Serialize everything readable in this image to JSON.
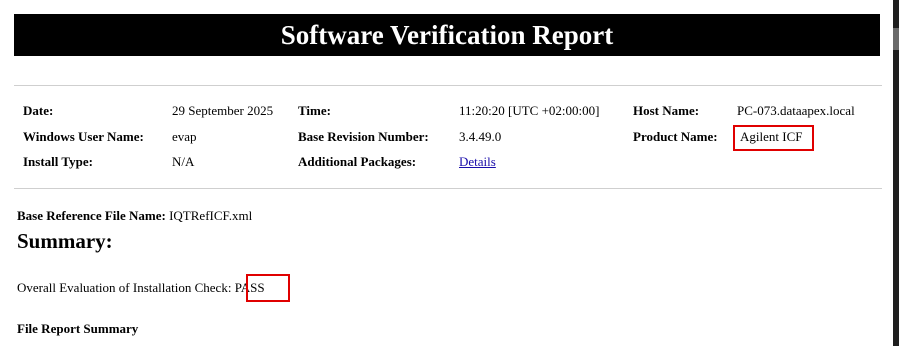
{
  "report": {
    "title": "Software Verification Report"
  },
  "info": {
    "date_label": "Date:",
    "date_value": "29 September 2025",
    "time_label": "Time:",
    "time_value": "11:20:20 [UTC +02:00:00]",
    "host_label": "Host Name:",
    "host_value": "PC-073.dataapex.local",
    "user_label": "Windows User Name:",
    "user_value": "evap",
    "revision_label": "Base Revision Number:",
    "revision_value": "3.4.49.0",
    "product_label": "Product Name:",
    "product_value": "Agilent ICF",
    "install_label": "Install Type:",
    "install_value": "N/A",
    "packages_label": "Additional Packages:",
    "packages_link": "Details"
  },
  "reference": {
    "label": "Base Reference File Name:",
    "value": "IQTRefICF.xml"
  },
  "summary": {
    "heading": "Summary:",
    "overall_label": "Overall Evaluation of Installation Check:",
    "overall_value": "PASS",
    "file_report_heading": "File Report Summary"
  },
  "colors": {
    "highlight": "#e00000",
    "link": "#1a0dab"
  }
}
